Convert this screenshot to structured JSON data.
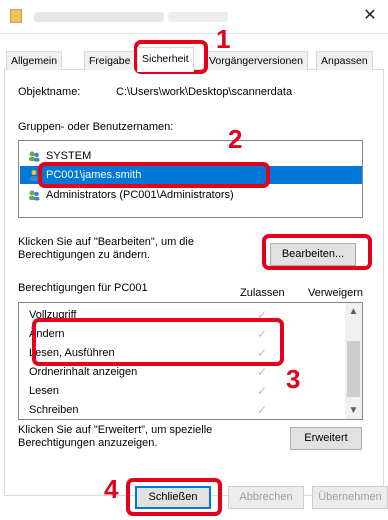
{
  "window": {
    "close_glyph": "✕"
  },
  "tabs": [
    {
      "label": "Allgemein"
    },
    {
      "label": "Freigabe"
    },
    {
      "label": "Sicherheit"
    },
    {
      "label": "Vorgängerversionen"
    },
    {
      "label": "Anpassen"
    }
  ],
  "object": {
    "label": "Objektname:",
    "value": "C:\\Users\\work\\Desktop\\scannerdata"
  },
  "groups": {
    "label": "Gruppen- oder Benutzernamen:",
    "items": [
      {
        "label": "SYSTEM",
        "icon": "users-icon"
      },
      {
        "label": "PC001\\james.smith",
        "icon": "user-icon"
      },
      {
        "label": "Administrators (PC001\\Administrators)",
        "icon": "users-icon"
      }
    ]
  },
  "edit": {
    "hint": "Klicken Sie auf \"Bearbeiten\", um die Berechtigungen zu ändern.",
    "button": "Bearbeiten..."
  },
  "permissions": {
    "title": "Berechtigungen für PC001",
    "col_allow": "Zulassen",
    "col_deny": "Verweigern",
    "rows": [
      {
        "name": "Vollzugriff",
        "allow": true
      },
      {
        "name": "Ändern",
        "allow": true
      },
      {
        "name": "Lesen, Ausführen",
        "allow": true
      },
      {
        "name": "Ordnerinhalt anzeigen",
        "allow": true
      },
      {
        "name": "Lesen",
        "allow": true
      },
      {
        "name": "Schreiben",
        "allow": true
      }
    ],
    "check_glyph": "✓"
  },
  "advanced": {
    "hint": "Klicken Sie auf \"Erweitert\", um spezielle Berechtigungen anzuzeigen.",
    "button": "Erweitert"
  },
  "footer": {
    "close": "Schließen",
    "cancel": "Abbrechen",
    "apply": "Übernehmen"
  },
  "callouts": [
    "1",
    "2",
    "3",
    "4"
  ],
  "colors": {
    "accent": "#0078d7",
    "callout": "#e2001a"
  }
}
